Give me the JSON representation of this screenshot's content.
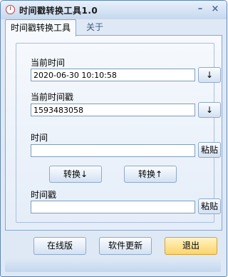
{
  "window": {
    "title": "时间戳转换工具1.0",
    "minimize_glyph": "–",
    "close_glyph": "×"
  },
  "tabs": [
    {
      "label": "时间戳转换工具",
      "active": true
    },
    {
      "label": "关于",
      "active": false
    }
  ],
  "converter": {
    "current_time_label": "当前时间",
    "current_time_value": "2020-06-30 10:10:58",
    "current_timestamp_label": "当前时间戳",
    "current_timestamp_value": "1593483058",
    "down_arrow": "↓",
    "time_label": "时间",
    "time_value": "",
    "timestamp_label": "时间戳",
    "timestamp_value": "",
    "paste_label": "粘贴",
    "convert_down_label": "转换↓",
    "convert_up_label": "转换↑"
  },
  "footer": {
    "online_label": "在线版",
    "update_label": "软件更新",
    "exit_label": "退出"
  },
  "colors": {
    "accent": "#8aa7cb",
    "exit_button": "#fbd46a",
    "window_bg": "#dfe9f5"
  }
}
